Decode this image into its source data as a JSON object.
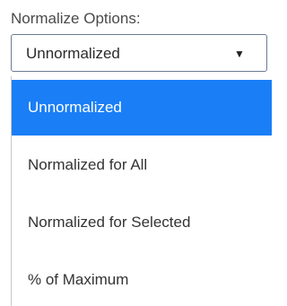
{
  "normalize": {
    "label": "Normalize Options:",
    "selected_value": "Unnormalized",
    "caret_glyph": "▼",
    "options": [
      {
        "label": "Unnormalized",
        "selected": true
      },
      {
        "label": "Normalized for All",
        "selected": false
      },
      {
        "label": "Normalized for Selected",
        "selected": false
      },
      {
        "label": "% of Maximum",
        "selected": false
      }
    ]
  },
  "colors": {
    "highlight": "#1a7ef7",
    "border": "#6b7c93"
  }
}
